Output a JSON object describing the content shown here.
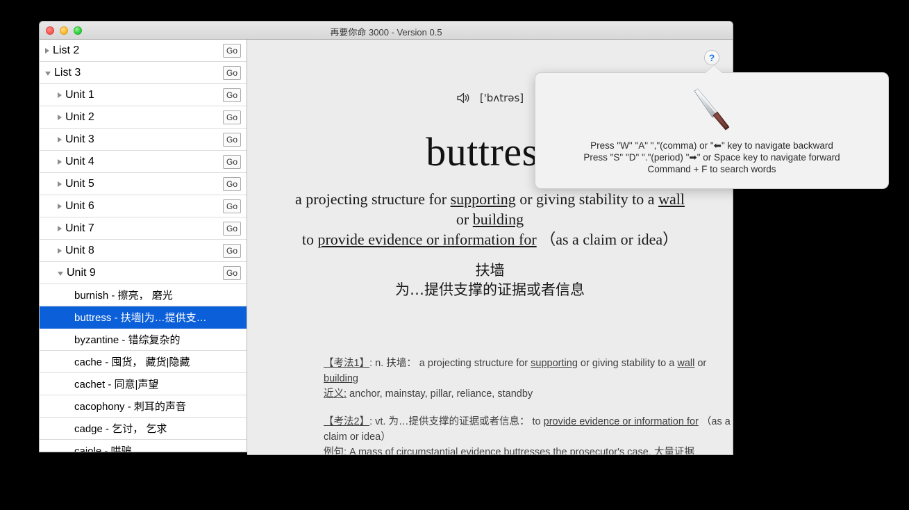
{
  "window": {
    "title": "再要你命 3000 - Version 0.5",
    "traffic_lights": [
      "close",
      "minimize",
      "zoom"
    ]
  },
  "sidebar": {
    "go_label": "Go",
    "tree": [
      {
        "label": "List 2",
        "level": "list",
        "expanded": false,
        "has_go": true
      },
      {
        "label": "List 3",
        "level": "list",
        "expanded": true,
        "has_go": true
      },
      {
        "label": "Unit 1",
        "level": "unit",
        "expanded": false,
        "has_go": true
      },
      {
        "label": "Unit 2",
        "level": "unit",
        "expanded": false,
        "has_go": true
      },
      {
        "label": "Unit 3",
        "level": "unit",
        "expanded": false,
        "has_go": true
      },
      {
        "label": "Unit 4",
        "level": "unit",
        "expanded": false,
        "has_go": true
      },
      {
        "label": "Unit 5",
        "level": "unit",
        "expanded": false,
        "has_go": true
      },
      {
        "label": "Unit 6",
        "level": "unit",
        "expanded": false,
        "has_go": true
      },
      {
        "label": "Unit 7",
        "level": "unit",
        "expanded": false,
        "has_go": true
      },
      {
        "label": "Unit 8",
        "level": "unit",
        "expanded": false,
        "has_go": true
      },
      {
        "label": "Unit 9",
        "level": "unit",
        "expanded": true,
        "has_go": true
      }
    ],
    "words": [
      {
        "text": "burnish - 擦亮， 磨光",
        "selected": false
      },
      {
        "text": "buttress - 扶墙|为…提供支…",
        "selected": true
      },
      {
        "text": "byzantine - 错综复杂的",
        "selected": false
      },
      {
        "text": "cache - 囤货， 藏货|隐藏",
        "selected": false
      },
      {
        "text": "cachet - 同意|声望",
        "selected": false
      },
      {
        "text": "cacophony - 刺耳的声音",
        "selected": false
      },
      {
        "text": "cadge - 乞讨， 乞求",
        "selected": false
      },
      {
        "text": "cajole - 哄骗",
        "selected": false
      }
    ]
  },
  "main": {
    "phonetic": "['bʌtrəs]",
    "headword": "buttress",
    "definitions": [
      {
        "parts": [
          {
            "t": "a projecting structure for ",
            "u": false
          },
          {
            "t": "supporting",
            "u": true
          },
          {
            "t": " or giving stability to a ",
            "u": false
          },
          {
            "t": "wall",
            "u": true
          }
        ]
      },
      {
        "parts": [
          {
            "t": "or ",
            "u": false
          },
          {
            "t": "building",
            "u": true
          }
        ]
      },
      {
        "parts": [
          {
            "t": "to ",
            "u": false
          },
          {
            "t": "provide evidence or information for",
            "u": true
          },
          {
            "t": " （as a claim or idea）",
            "u": false
          }
        ]
      }
    ],
    "cn_definitions": [
      "扶墙",
      "为…提供支撑的证据或者信息"
    ],
    "notes": [
      {
        "tag": "【考法1】",
        "parts": [
          {
            "t": ": n. 扶墙：  a projecting structure for ",
            "u": false
          },
          {
            "t": "supporting",
            "u": true
          },
          {
            "t": " or giving stability to a ",
            "u": false
          },
          {
            "t": "wall",
            "u": true
          },
          {
            "t": " or ",
            "u": false
          },
          {
            "t": "building",
            "u": true
          }
        ],
        "sub_tag": "近义:",
        "sub_text": " anchor, mainstay, pillar, reliance, standby"
      },
      {
        "tag": "【考法2】",
        "parts": [
          {
            "t": ": vt. 为…提供支撑的证据或者信息：  to ",
            "u": false
          },
          {
            "t": "provide evidence or information for",
            "u": true
          },
          {
            "t": "  （as a claim or idea）",
            "u": false
          }
        ],
        "sub_tag": "例句:",
        "sub_text": " A mass of circumstantial evidence buttresses the prosecutor's case. 大量证据"
      }
    ]
  },
  "help": {
    "button_label": "?",
    "icon": "knife-icon",
    "lines": [
      "Press \"W\" \"A\" \",\"(comma) or \"⬅\" key to navigate backward",
      "Press \"S\" \"D\" \".\"(period) \"➡\" or Space key to navigate forward",
      "Command + F to search words"
    ]
  },
  "colors": {
    "selection_blue": "#0b5fd8",
    "panel_gray": "#ececec",
    "help_blue": "#1b7ae8"
  }
}
